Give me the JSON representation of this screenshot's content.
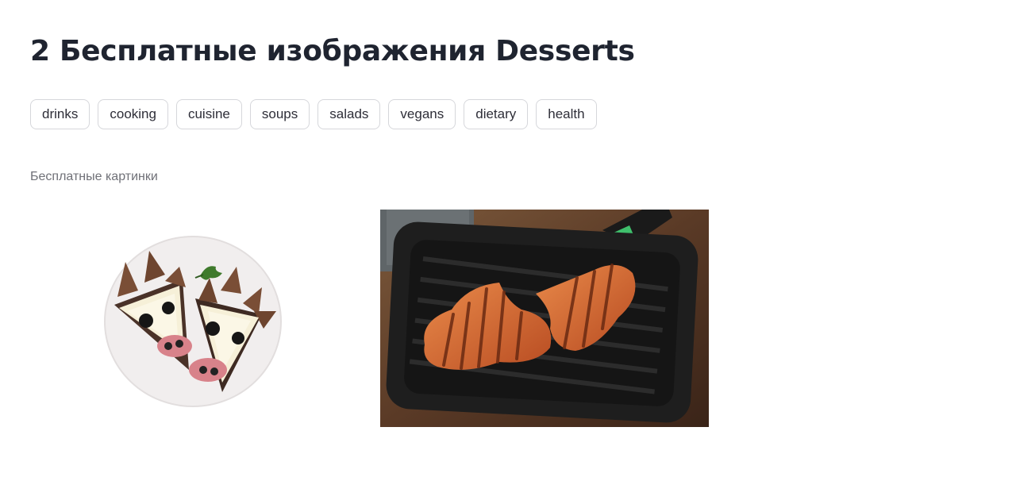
{
  "header": {
    "title": "2 Бесплатные изображения Desserts"
  },
  "tags": [
    {
      "label": "drinks"
    },
    {
      "label": "cooking"
    },
    {
      "label": "cuisine"
    },
    {
      "label": "soups"
    },
    {
      "label": "salads"
    },
    {
      "label": "vegans"
    },
    {
      "label": "dietary"
    },
    {
      "label": "health"
    }
  ],
  "gallery": {
    "label": "Бесплатные картинки",
    "images": [
      {
        "subject": "plate with cow-face sandwiches"
      },
      {
        "subject": "grilled meat in grill pan"
      }
    ]
  }
}
